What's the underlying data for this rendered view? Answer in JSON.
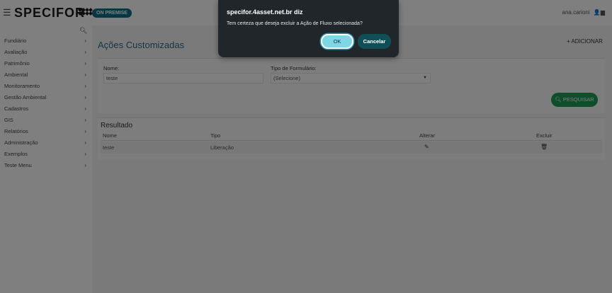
{
  "header": {
    "logo_text": "SPECIFOR",
    "badge": "ON PREMISE",
    "user": "ana.carioni"
  },
  "sidebar": {
    "items": [
      {
        "label": "Fundiário"
      },
      {
        "label": "Avaliação"
      },
      {
        "label": "Patrimônio"
      },
      {
        "label": "Ambiental"
      },
      {
        "label": "Monitoramento"
      },
      {
        "label": "Gestão Ambiental"
      },
      {
        "label": "Cadastros"
      },
      {
        "label": "GIS"
      },
      {
        "label": "Relatórios"
      },
      {
        "label": "Administração"
      },
      {
        "label": "Exemplos"
      },
      {
        "label": "Teste Menu"
      }
    ]
  },
  "main": {
    "title": "Ações Customizadas",
    "add_label": "+ ADICIONAR",
    "filters": {
      "nome_label": "Nome:",
      "nome_value": "teste",
      "tipo_label": "Tipo de Formulário:",
      "tipo_value": "(Selecione)"
    },
    "search_label": "PESQUISAR",
    "results": {
      "title": "Resultado",
      "columns": [
        "Nome",
        "Tipo",
        "Alterar",
        "Excluir"
      ],
      "rows": [
        {
          "nome": "teste",
          "tipo": "Liberação"
        }
      ]
    }
  },
  "dialog": {
    "title": "specifor.4asset.net.br diz",
    "message": "Tem certeza que deseja excluir a Ação de Fluxo selecionada?",
    "ok_label": "OK",
    "cancel_label": "Cancelar"
  }
}
